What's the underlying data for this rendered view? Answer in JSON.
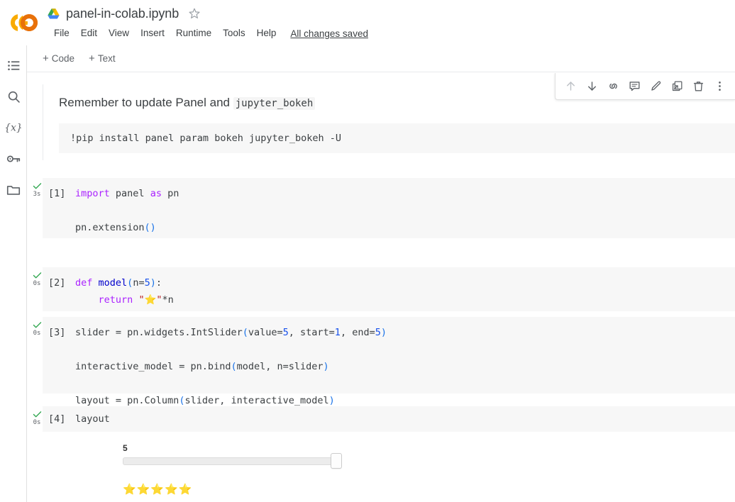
{
  "header": {
    "logo_name": "colab-logo",
    "drive_icon": "google-drive-icon",
    "filename": "panel-in-colab.ipynb",
    "star_glyph": "☆",
    "menus": [
      "File",
      "Edit",
      "View",
      "Insert",
      "Runtime",
      "Tools",
      "Help"
    ],
    "save_status": "All changes saved"
  },
  "rail": {
    "items": [
      {
        "name": "table-of-contents-icon",
        "label": "Table of contents"
      },
      {
        "name": "search-icon",
        "label": "Find and replace"
      },
      {
        "name": "variables-icon",
        "label": "Variables"
      },
      {
        "name": "secrets-key-icon",
        "label": "Secrets"
      },
      {
        "name": "files-folder-icon",
        "label": "Files"
      }
    ]
  },
  "toolbar": {
    "add_code_label": "Code",
    "add_text_label": "Text",
    "plus_glyph": "+"
  },
  "cell_toolbar": {
    "buttons": [
      {
        "name": "move-cell-up-icon",
        "label": "Move cell up",
        "disabled": true
      },
      {
        "name": "move-cell-down-icon",
        "label": "Move cell down",
        "disabled": false
      },
      {
        "name": "link-to-cell-icon",
        "label": "Link to cell",
        "disabled": false
      },
      {
        "name": "add-comment-icon",
        "label": "Add a comment",
        "disabled": false
      },
      {
        "name": "edit-icon",
        "label": "Edit",
        "disabled": false
      },
      {
        "name": "copy-to-drive-icon",
        "label": "Open in new tab",
        "disabled": false
      },
      {
        "name": "delete-cell-icon",
        "label": "Delete cell",
        "disabled": false
      },
      {
        "name": "more-options-icon",
        "label": "More cell actions",
        "disabled": false
      }
    ]
  },
  "cells": [
    {
      "type": "markdown",
      "heading_prefix": "Remember to update Panel and ",
      "heading_code": "jupyter_bokeh",
      "pre": "!pip install panel param bokeh jupyter_bokeh -U"
    },
    {
      "type": "code",
      "prompt": "[1]",
      "exec_time": "3s",
      "status": "success",
      "lines": [
        "import panel as pn",
        "",
        "pn.extension()"
      ]
    },
    {
      "type": "code",
      "prompt": "[2]",
      "exec_time": "0s",
      "status": "success",
      "lines": [
        "def model(n=5):",
        "    return \"⭐\"*n"
      ]
    },
    {
      "type": "code",
      "prompt": "[3]",
      "exec_time": "0s",
      "status": "success",
      "lines": [
        "slider = pn.widgets.IntSlider(value=5, start=1, end=5)",
        "",
        "interactive_model = pn.bind(model, n=slider)",
        "",
        "layout = pn.Column(slider, interactive_model)"
      ]
    },
    {
      "type": "code",
      "prompt": "[4]",
      "exec_time": "0s",
      "status": "success",
      "lines": [
        "layout"
      ]
    }
  ],
  "output": {
    "slider_value_label": "5",
    "slider_min": 1,
    "slider_max": 5,
    "slider_value": 5,
    "stars": "⭐⭐⭐⭐⭐"
  },
  "colors": {
    "colab_orange": "#f9ab00",
    "colab_orange_dark": "#e8710a",
    "success_green": "#34a853",
    "code_bg": "#f7f7f7",
    "star_gold": "#f5b400"
  }
}
